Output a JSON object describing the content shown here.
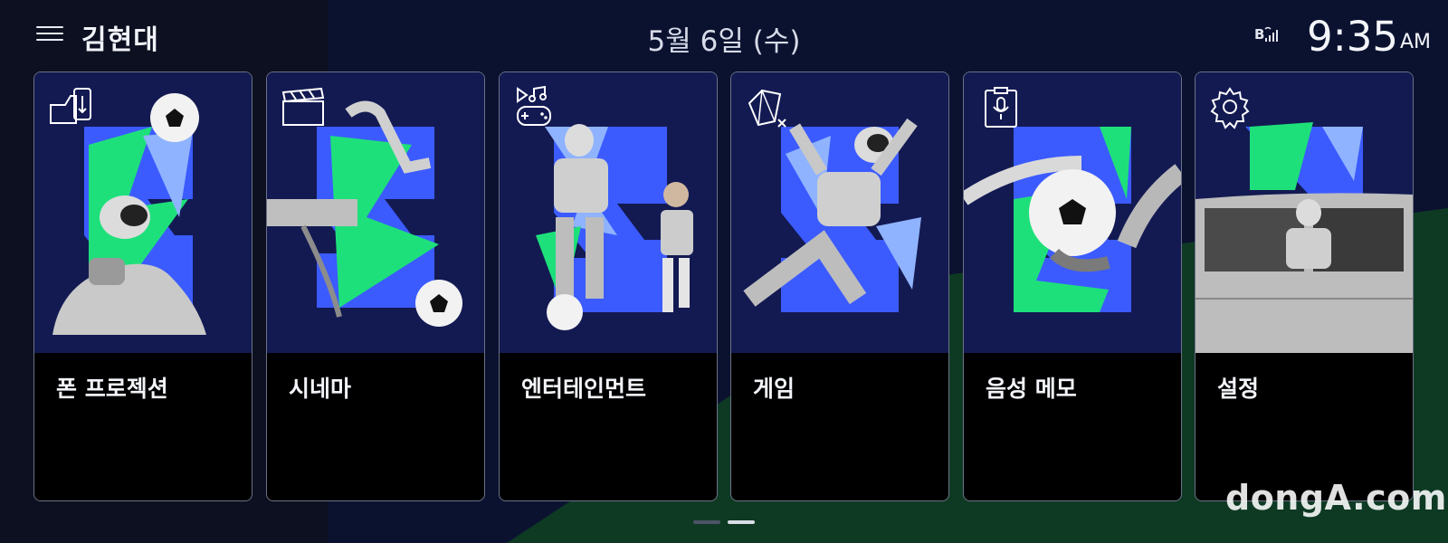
{
  "header": {
    "profile_name": "김현대",
    "date": "5월 6일 (수)",
    "time": "9:35",
    "ampm": "AM",
    "status_icons": [
      "menu-icon",
      "bluetooth-signal-icon"
    ]
  },
  "cards": [
    {
      "label": "폰 프로젝션",
      "icon": "phone-projection-icon"
    },
    {
      "label": "시네마",
      "icon": "clapperboard-icon"
    },
    {
      "label": "엔터테인먼트",
      "icon": "entertainment-icon"
    },
    {
      "label": "게임",
      "icon": "game-cube-icon"
    },
    {
      "label": "음성 메모",
      "icon": "voice-memo-icon"
    },
    {
      "label": "설정",
      "icon": "gear-icon"
    }
  ],
  "pager": {
    "pages": 2,
    "current_page": 2
  },
  "watermark": "dongA.com",
  "colors": {
    "background": "#0b1230",
    "card_art": "#131a52",
    "accent_green": "#1ee07a",
    "accent_blue": "#3b5bff",
    "card_border": "#6c7186"
  }
}
